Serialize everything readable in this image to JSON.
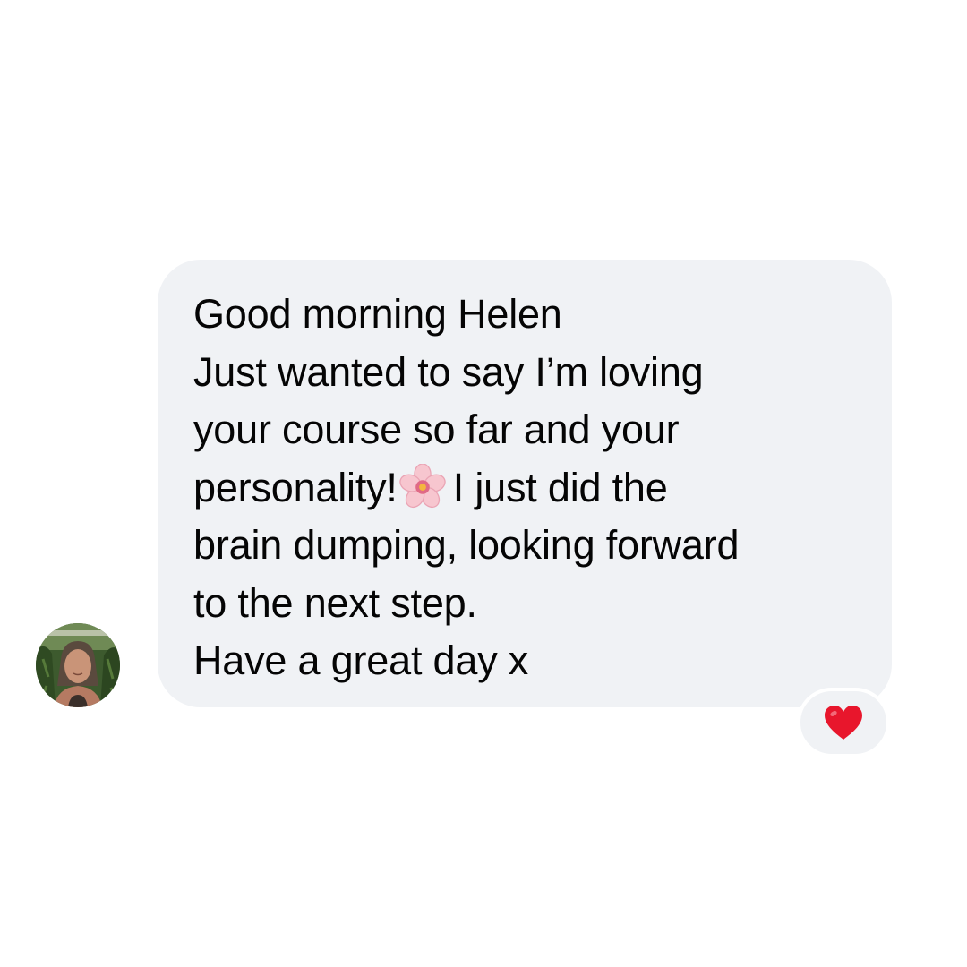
{
  "message": {
    "lines": [
      "Good morning Helen",
      "Just wanted to say I’m loving",
      "your course so far and your",
      "personality!",
      "I just did the",
      "brain dumping, looking forward",
      "to the next step.",
      "Have a great day x"
    ],
    "inline_emoji": "cherry-blossom-icon",
    "bubble_color": "#f0f2f5",
    "text_color": "#050505"
  },
  "sender": {
    "avatar": "avatar"
  },
  "reaction": {
    "icon": "heart-icon",
    "color": "#e8162c"
  }
}
